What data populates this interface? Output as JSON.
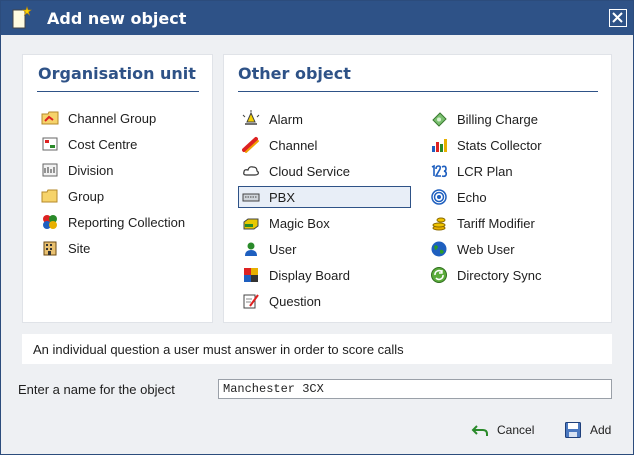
{
  "dialog": {
    "title": "Add new object",
    "close_label": "Close"
  },
  "organisation": {
    "heading": "Organisation unit",
    "items": [
      {
        "label": "Channel Group",
        "icon": "channel-group-icon"
      },
      {
        "label": "Cost Centre",
        "icon": "cost-centre-icon"
      },
      {
        "label": "Division",
        "icon": "division-icon"
      },
      {
        "label": "Group",
        "icon": "folder-icon"
      },
      {
        "label": "Reporting Collection",
        "icon": "reporting-collection-icon"
      },
      {
        "label": "Site",
        "icon": "site-icon"
      }
    ]
  },
  "other": {
    "heading": "Other object",
    "left_items": [
      {
        "label": "Alarm",
        "icon": "alarm-icon"
      },
      {
        "label": "Channel",
        "icon": "channel-icon"
      },
      {
        "label": "Cloud Service",
        "icon": "cloud-icon"
      },
      {
        "label": "PBX",
        "icon": "pbx-icon",
        "selected": true
      },
      {
        "label": "Magic Box",
        "icon": "magic-box-icon"
      },
      {
        "label": "User",
        "icon": "user-icon"
      },
      {
        "label": "Display Board",
        "icon": "display-board-icon"
      },
      {
        "label": "Question",
        "icon": "question-icon"
      }
    ],
    "right_items": [
      {
        "label": "Billing Charge",
        "icon": "billing-charge-icon"
      },
      {
        "label": "Stats Collector",
        "icon": "stats-collector-icon"
      },
      {
        "label": "LCR Plan",
        "icon": "lcr-plan-icon"
      },
      {
        "label": "Echo",
        "icon": "echo-icon"
      },
      {
        "label": "Tariff Modifier",
        "icon": "tariff-modifier-icon"
      },
      {
        "label": "Web User",
        "icon": "web-user-icon"
      },
      {
        "label": "Directory Sync",
        "icon": "directory-sync-icon"
      }
    ]
  },
  "description": "An individual question a user must answer in order to score calls",
  "name_field": {
    "label": "Enter a name for the object",
    "value": "Manchester 3CX"
  },
  "buttons": {
    "cancel": "Cancel",
    "add": "Add"
  },
  "colors": {
    "titlebar": "#2e5287",
    "heading": "#2e5287",
    "background": "#eef0f3",
    "selected_bg": "#e8eef7"
  }
}
